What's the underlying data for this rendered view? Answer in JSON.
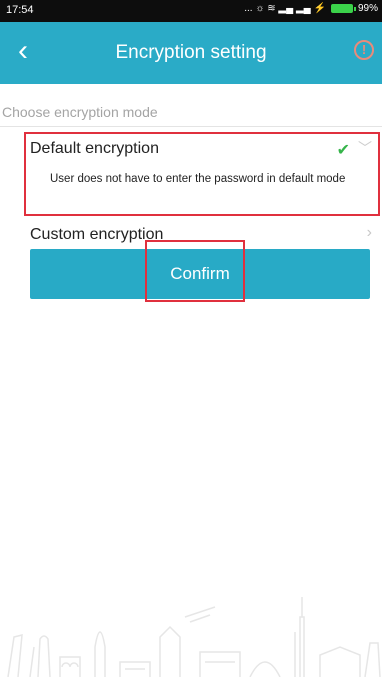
{
  "status_bar": {
    "time": "17:54",
    "icons": "... ☼ ≋ ▂▄ ▂▄ ⚡",
    "battery_percent": "99%"
  },
  "header": {
    "back_icon": "‹",
    "title": "Encryption setting",
    "info_icon": "!"
  },
  "content": {
    "section_label": "Choose encryption mode",
    "default_option": {
      "label": "Default encryption",
      "description": "User does not have to enter the password in default mode",
      "selected": true,
      "check_icon": "✔",
      "chevron_icon": "﹀"
    },
    "custom_option": {
      "label": "Custom encryption",
      "chevron_icon": "›"
    },
    "confirm_label": "Confirm"
  },
  "colors": {
    "header_bg": "#2aabc7",
    "button_bg": "#28aac6",
    "highlight": "#e0303e",
    "check": "#36b44a"
  }
}
